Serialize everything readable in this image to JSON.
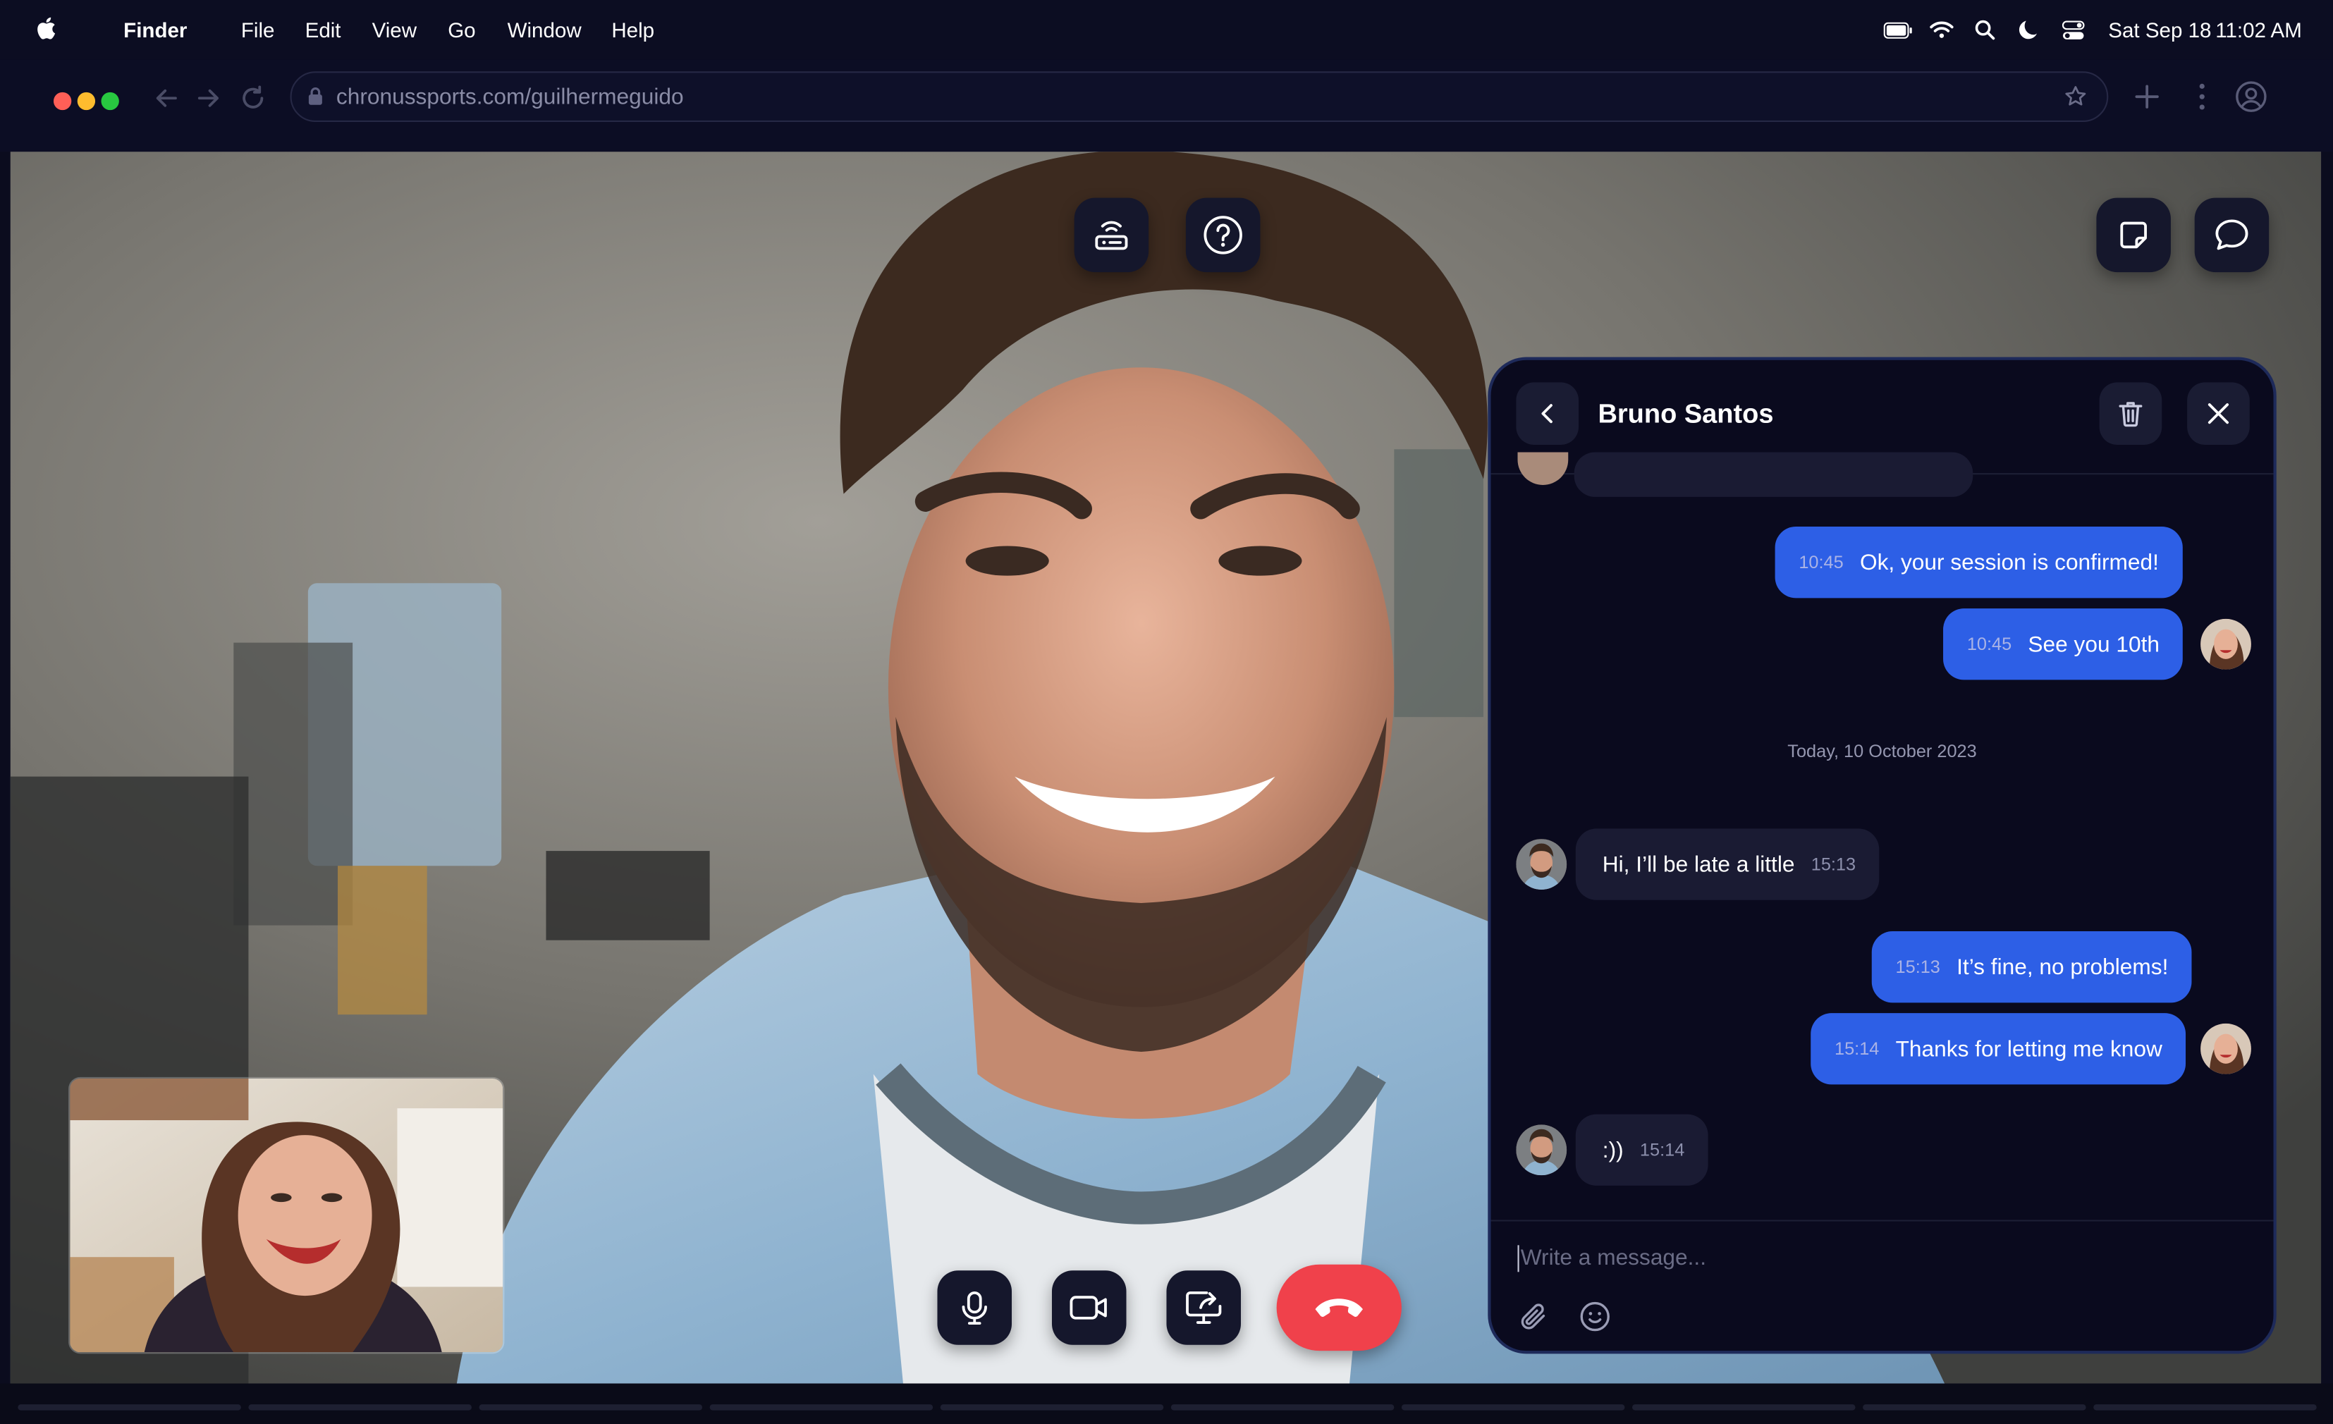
{
  "menubar": {
    "app_name": "Finder",
    "items": [
      "File",
      "Edit",
      "View",
      "Go",
      "Window",
      "Help"
    ],
    "date": "Sat Sep 18",
    "time": "11:02 AM",
    "status_icons": [
      "battery-icon",
      "wifi-icon",
      "search-icon",
      "moon-icon",
      "control-center-icon"
    ]
  },
  "browser": {
    "url": "chronussports.com/guilhermeguido",
    "traffic_light_colors": [
      "#ff5f57",
      "#febc2e",
      "#28c840"
    ]
  },
  "call": {
    "top_controls": [
      "network-icon",
      "help-icon"
    ],
    "top_right_controls": [
      "notes-icon",
      "chat-icon"
    ],
    "bottom_controls": [
      "microphone-icon",
      "camera-icon",
      "screen-share-icon",
      "hang-up-icon"
    ],
    "hangup_color": "#f0414b"
  },
  "chat": {
    "title": "Bruno Santos",
    "date_separator": "Today, 10 October 2023",
    "messages": [
      {
        "from": "me",
        "time": "10:45",
        "text": "Ok, your session is confirmed!"
      },
      {
        "from": "me",
        "time": "10:45",
        "text": "See you 10th"
      },
      {
        "from": "them",
        "time": "15:13",
        "text": "Hi, I’ll be late a little"
      },
      {
        "from": "me",
        "time": "15:13",
        "text": "It’s fine, no problems!"
      },
      {
        "from": "me",
        "time": "15:14",
        "text": "Thanks for letting me know"
      },
      {
        "from": "them",
        "time": "15:14",
        "text": ":))"
      }
    ],
    "composer_placeholder": "Write a message...",
    "accent_color": "#2d5fe6"
  }
}
